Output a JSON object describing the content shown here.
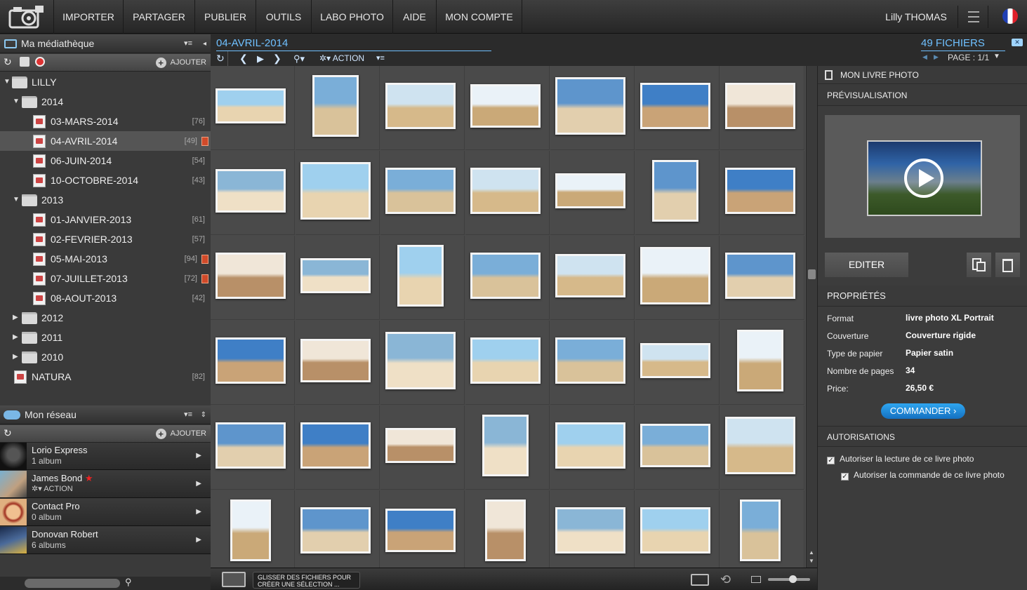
{
  "menu": {
    "items": [
      "IMPORTER",
      "PARTAGER",
      "PUBLIER",
      "OUTILS",
      "LABO PHOTO",
      "AIDE",
      "MON COMPTE"
    ],
    "user_name": "Lilly THOMAS"
  },
  "library": {
    "title": "Ma médiathèque",
    "add_label": "AJOUTER",
    "tree": [
      {
        "label": "LILLY",
        "count": ""
      },
      {
        "label": "2014",
        "count": ""
      },
      {
        "label": "03-MARS-2014",
        "count": "[76]"
      },
      {
        "label": "04-AVRIL-2014",
        "count": "[49]"
      },
      {
        "label": "06-JUIN-2014",
        "count": "[54]"
      },
      {
        "label": "10-OCTOBRE-2014",
        "count": "[43]"
      },
      {
        "label": "2013",
        "count": ""
      },
      {
        "label": "01-JANVIER-2013",
        "count": "[61]"
      },
      {
        "label": "02-FEVRIER-2013",
        "count": "[57]"
      },
      {
        "label": "05-MAI-2013",
        "count": "[94]"
      },
      {
        "label": "07-JUILLET-2013",
        "count": "[72]"
      },
      {
        "label": "08-AOUT-2013",
        "count": "[42]"
      },
      {
        "label": "2012",
        "count": ""
      },
      {
        "label": "2011",
        "count": ""
      },
      {
        "label": "2010",
        "count": ""
      },
      {
        "label": "NATURA",
        "count": "[82]"
      }
    ]
  },
  "network": {
    "title": "Mon réseau",
    "add_label": "AJOUTER",
    "contacts": [
      {
        "name": "Lorio Express",
        "sub": "1 album"
      },
      {
        "name": "James Bond",
        "sub": "ACTION"
      },
      {
        "name": "Contact Pro",
        "sub": "0 album"
      },
      {
        "name": "Donovan Robert",
        "sub": "6 albums"
      }
    ]
  },
  "album": {
    "name": "04-AVRIL-2014",
    "file_count": "49 FICHIERS",
    "page_label": "PAGE : 1/1",
    "action_label": "ACTION",
    "drop_hint_line1": "GLISSER DES FICHIERS POUR",
    "drop_hint_line2": "CRÉER UNE SÉLECTION ..."
  },
  "photobook": {
    "title": "MON LIVRE PHOTO",
    "preview_label": "PRÉVISUALISATION",
    "edit_label": "EDITER",
    "properties_label": "PROPRIÉTÉS",
    "properties": [
      {
        "key": "Format",
        "value": "livre photo XL Portrait"
      },
      {
        "key": "Couverture",
        "value": "Couverture rigide"
      },
      {
        "key": "Type de papier",
        "value": "Papier satin"
      },
      {
        "key": "Nombre de pages",
        "value": "34"
      },
      {
        "key": "Price:",
        "value": "26,50 €"
      }
    ],
    "order_label": "COMMANDER",
    "permissions_label": "AUTORISATIONS",
    "permissions": [
      "Autoriser la lecture de ce livre photo",
      "Autoriser la commande de ce livre photo"
    ]
  },
  "colors": {
    "accent": "#2a9de8",
    "album_title": "#6fc0ff"
  }
}
